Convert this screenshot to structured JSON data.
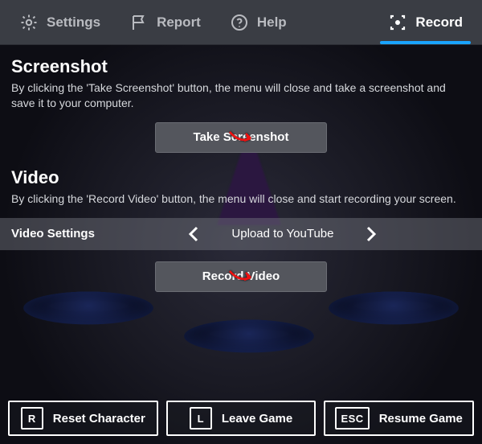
{
  "topbar": {
    "tabs": [
      {
        "label": "Settings"
      },
      {
        "label": "Report"
      },
      {
        "label": "Help"
      },
      {
        "label": "Record"
      }
    ],
    "active_index": 3
  },
  "screenshot": {
    "title": "Screenshot",
    "desc": "By clicking the 'Take Screenshot' button, the menu will close and take a screenshot and save it to your computer.",
    "button": "Take Screenshot"
  },
  "video": {
    "title": "Video",
    "desc": "By clicking the 'Record Video' button, the menu will close and start recording your screen.",
    "settings_label": "Video Settings",
    "settings_value": "Upload to YouTube",
    "button": "Record Video"
  },
  "footer": {
    "reset": {
      "key": "R",
      "label": "Reset Character"
    },
    "leave": {
      "key": "L",
      "label": "Leave Game"
    },
    "resume": {
      "key": "ESC",
      "label": "Resume Game"
    }
  },
  "colors": {
    "accent": "#1aa3ff",
    "annotation": "#e11"
  }
}
